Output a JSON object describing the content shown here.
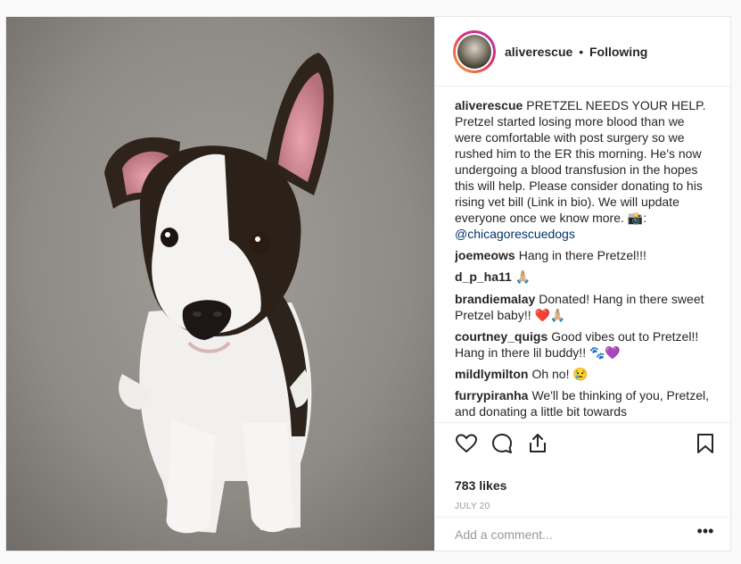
{
  "post": {
    "author": "aliverescue",
    "separator": "•",
    "follow_status": "Following",
    "caption": {
      "user": "aliverescue",
      "text": "PRETZEL NEEDS YOUR HELP. Pretzel started losing more blood than we were comfortable with post surgery so we rushed him to the ER this morning. He's now undergoing a blood transfusion in the hopes this will help. Please consider donating to his rising vet bill (Link in bio). We will update everyone once we know more. 📸:",
      "mention": "@chicagorescuedogs"
    },
    "comments": [
      {
        "user": "joemeows",
        "text": "Hang in there Pretzel!!!"
      },
      {
        "user": "d_p_ha11",
        "text": "🙏🏼"
      },
      {
        "user": "brandiemalay",
        "text": "Donated! Hang in there sweet Pretzel baby!! ❤️🙏🏼"
      },
      {
        "user": "courtney_quigs",
        "text": "Good vibes out to Pretzel!! Hang in there lil buddy!! 🐾💜"
      },
      {
        "user": "mildlymilton",
        "text": "Oh no! 😢"
      },
      {
        "user": "furrypiranha",
        "text": "We'll be thinking of you, Pretzel, and donating a little bit towards"
      }
    ],
    "likes": "783 likes",
    "date": "JULY 20",
    "add_comment_placeholder": "Add a comment...",
    "more_label": "•••",
    "icons": {
      "like": "heart-icon",
      "comment": "comment-bubble-icon",
      "share": "share-icon",
      "save": "bookmark-icon"
    },
    "colors": {
      "ring_start": "#f9a534",
      "ring_mid": "#e1306c",
      "ring_end": "#a43ab5",
      "mention": "#003569",
      "muted": "#999999"
    }
  }
}
